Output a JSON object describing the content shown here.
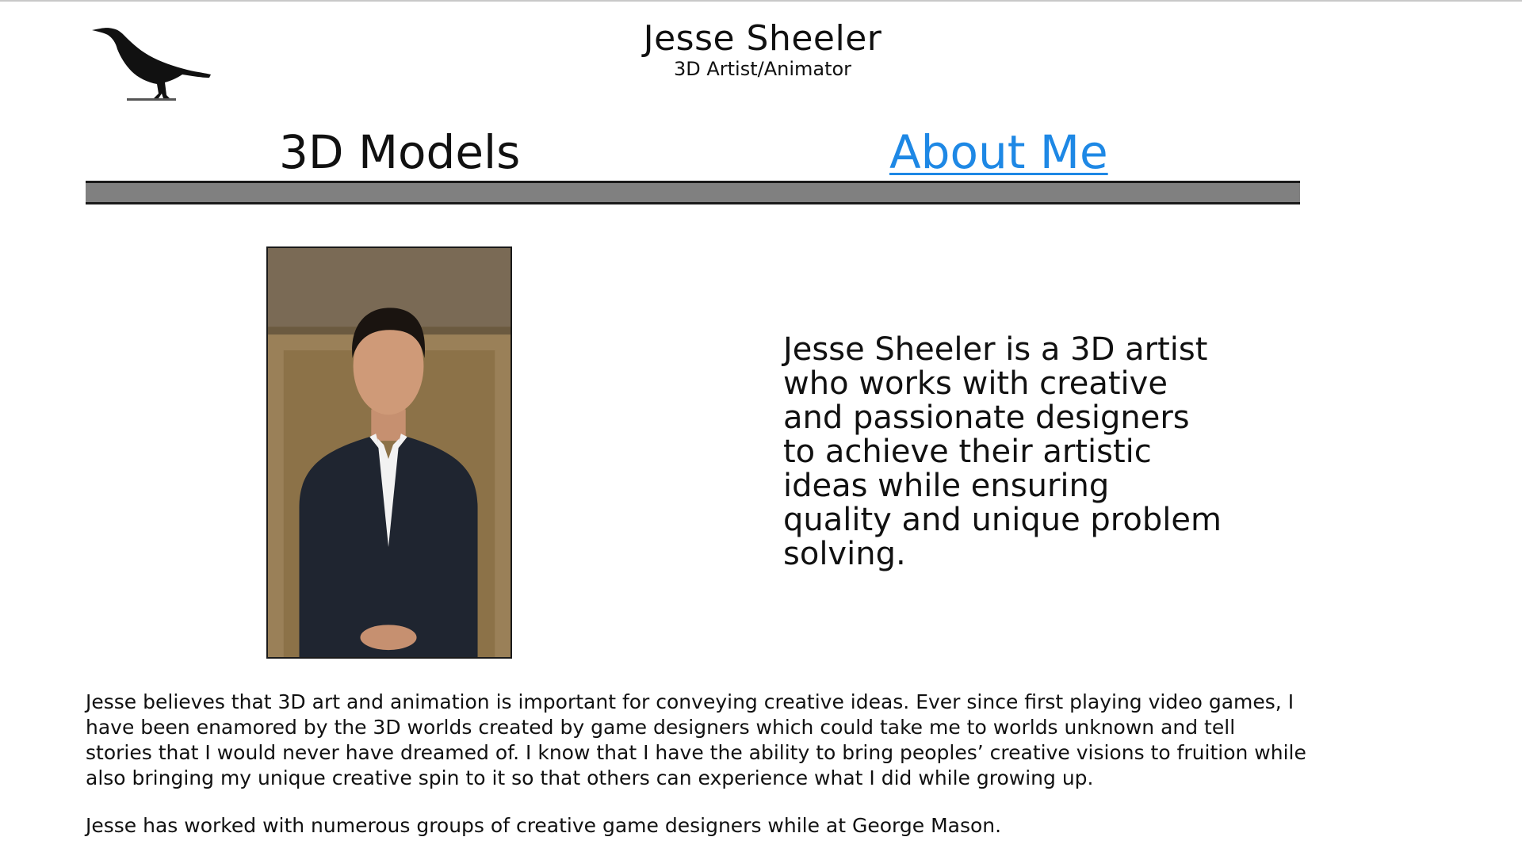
{
  "header": {
    "name": "Jesse Sheeler",
    "subtitle": "3D Artist/Animator",
    "logo_icon": "crow-logo-icon"
  },
  "nav": {
    "items": [
      {
        "label": "3D Models"
      },
      {
        "label": "About Me"
      }
    ]
  },
  "about": {
    "portrait_icon": "portrait-photo",
    "lead": "Jesse Sheeler is a 3D artist who works with creative and passionate designers to achieve their artistic ideas while ensuring quality and unique problem solving.",
    "paragraphs": [
      "Jesse believes that 3D art and animation is important for conveying creative ideas. Ever since first playing video games, I have been enamored by the 3D worlds created by game designers which could take me to worlds unknown and tell stories that I would never have dreamed of. I know that I have the ability to bring peoples’ creative visions to fruition while also bringing my unique creative spin to it so that others can experience what I did while growing up.",
      "Jesse has worked with numerous groups of creative game designers while at George Mason."
    ]
  },
  "colors": {
    "link": "#1e88e5",
    "bar": "#808080",
    "text": "#111111"
  }
}
